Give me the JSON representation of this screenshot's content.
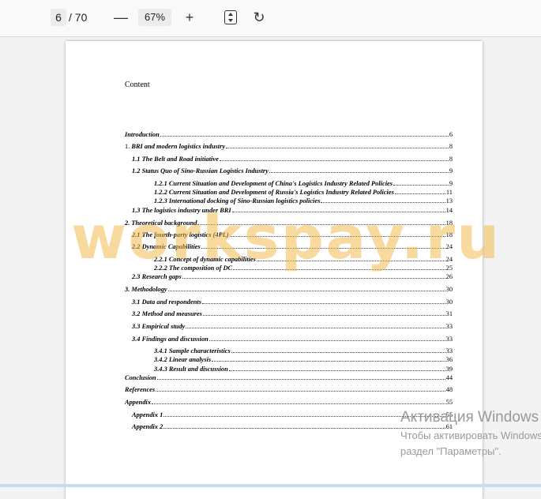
{
  "toolbar": {
    "page_number": "6",
    "page_total": "/ 70",
    "zoom_out_icon": "minus-icon",
    "zoom_out_glyph": "—",
    "zoom_value": "67%",
    "zoom_in_icon": "plus-icon",
    "zoom_in_glyph": "+",
    "fit_icon": "fit-page-icon",
    "rotate_icon": "rotate-icon",
    "rotate_glyph": "↻"
  },
  "document": {
    "title": "Content",
    "toc": [
      {
        "num": "",
        "text": "Introduction",
        "page": "6"
      },
      {
        "num": "1. ",
        "text": "BRI and modern logistics industry",
        "page": "8"
      },
      {
        "num": "",
        "text": "1.1 The Belt and Road initiative",
        "page": "8"
      },
      {
        "num": "",
        "text": "1.2 Status Quo of Sino-Russian Logistics Industry",
        "page": "9"
      },
      {
        "num": "",
        "text": "1.2.1 Current Situation and Development of China's Logistics Industry Related Policies",
        "page": "9"
      },
      {
        "num": "",
        "text": "1.2.2 Current Situation and Development of Russia's Logistics Industry Related Policies",
        "page": "11"
      },
      {
        "num": "",
        "text": "1.2.3 International docking of Sino-Russian logistics policies",
        "page": "13"
      },
      {
        "num": "",
        "text": "1.3 The logistics industry under BRI",
        "page": "14"
      },
      {
        "num": "",
        "text": "2. Theoretical background",
        "page": "18"
      },
      {
        "num": "",
        "text": "2.1 The fourth-party logistics (4PL)",
        "page": "18"
      },
      {
        "num": "",
        "text": "2.2 Dynamic Capabilities",
        "page": "24"
      },
      {
        "num": "",
        "text": "2.2.1 Concept of dynamic capabilities",
        "page": "24"
      },
      {
        "num": "",
        "text": "2.2.2 The composition of DC",
        "page": "25"
      },
      {
        "num": "",
        "text": "2.3 Research gaps",
        "page": "26"
      },
      {
        "num": "",
        "text": "3. Methodology",
        "page": "30"
      },
      {
        "num": "",
        "text": "3.1 Data and respondents",
        "page": "30"
      },
      {
        "num": "",
        "text": "3.2 Method and measures",
        "page": "31"
      },
      {
        "num": "",
        "text": "3.3 Empirical study",
        "page": "33"
      },
      {
        "num": "",
        "text": "3.4 Findings and discussion",
        "page": "33"
      },
      {
        "num": "",
        "text": "3.4.1 Sample characteristics",
        "page": "33"
      },
      {
        "num": "",
        "text": "3.4.2 Linear analysis",
        "page": "36"
      },
      {
        "num": "",
        "text": "3.4.3 Result and discussion",
        "page": "39"
      },
      {
        "num": "",
        "text": "Conclusion",
        "page": "44"
      },
      {
        "num": "",
        "text": "References",
        "page": "48"
      },
      {
        "num": "",
        "text": "Appendix",
        "page": "55"
      },
      {
        "num": "",
        "text": "Appendix 1",
        "page": "55"
      },
      {
        "num": "",
        "text": "Appendix 2",
        "page": "61"
      }
    ]
  },
  "watermark": "workspay.ru",
  "activation": {
    "title": "Активация Windows",
    "line1": "Чтобы активировать Windows",
    "line2": "раздел \"Параметры\"."
  }
}
